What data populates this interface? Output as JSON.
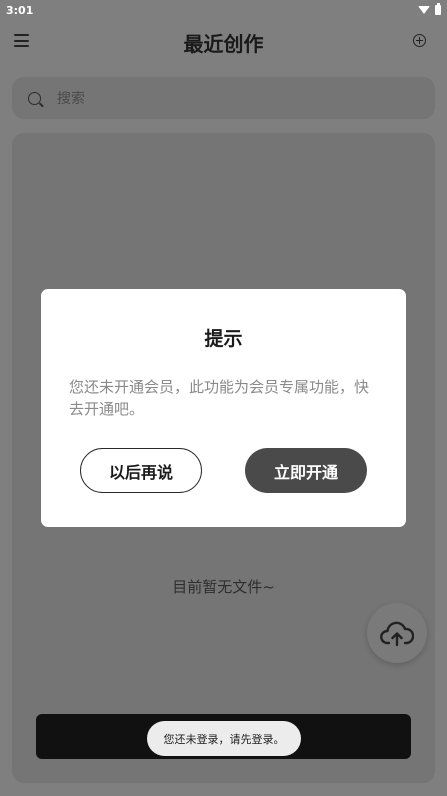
{
  "status_bar": {
    "time": "3:01"
  },
  "header": {
    "title": "最近创作"
  },
  "search": {
    "placeholder": "搜索"
  },
  "empty_state": {
    "text": "目前暂无文件~"
  },
  "dialog": {
    "title": "提示",
    "message": "您还未开通会员，此功能为会员专属功能，快去开通吧。",
    "cancel_label": "以后再说",
    "confirm_label": "立即开通"
  },
  "toast": {
    "text": "您还未登录，请先登录。"
  },
  "icons": {
    "menu": "menu-icon",
    "add": "add-circle-icon",
    "search": "search-icon",
    "upload": "cloud-upload-icon",
    "wifi": "wifi-icon",
    "battery": "battery-icon"
  },
  "colors": {
    "dialog_confirm": "#4a4a4a",
    "toast_bar": "#111111",
    "overlay": "#7f7f7f"
  }
}
